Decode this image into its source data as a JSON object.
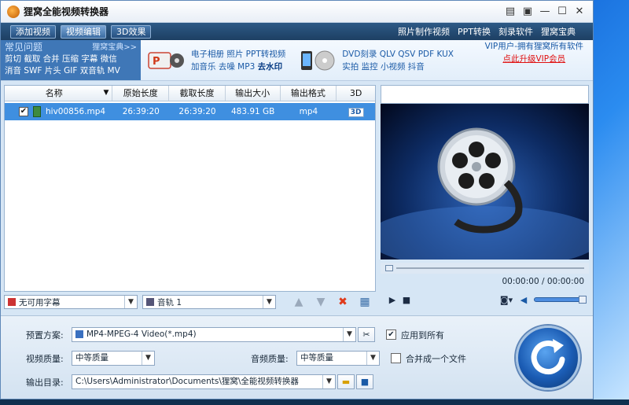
{
  "window": {
    "title": "狸窝全能视频转换器"
  },
  "window_controls": {
    "menu": "▤",
    "skin": "▣",
    "minimize": "—",
    "maximize": "☐",
    "close": "✕"
  },
  "toolbar": {
    "add_video": "添加视频",
    "edit_video": "视频编辑",
    "effect_3d": "3D效果",
    "links": [
      "照片制作视频",
      "PPT转换",
      "刻录软件",
      "狸窝宝典"
    ]
  },
  "banner": {
    "faq_title": "常见问题",
    "faq_more": "狸窝宝典>>",
    "faq_line1": "剪切 截取 合并 压缩 字幕 微信",
    "faq_line2": "消音 SWF 片头 GIF 双音轨 MV",
    "promo1_line1": "电子相册 照片 PPT转视频",
    "promo1_line2_a": "加音乐 去噪 MP3 ",
    "promo1_line2_b": "去水印",
    "promo2_line1": "DVD刻录 QLV QSV PDF KUX",
    "promo2_line2": "实拍 监控 小视频 抖音",
    "vip_line": "VIP用户-拥有狸窝所有软件",
    "vip_link": "点此升级VIP会员"
  },
  "filelist": {
    "headers": [
      "名称",
      "原始长度",
      "截取长度",
      "输出大小",
      "输出格式",
      "3D"
    ],
    "rows": [
      {
        "checked": "✔",
        "name": "hiv00856.mp4",
        "original": "26:39:20",
        "cut": "26:39:20",
        "size": "483.91 GB",
        "format": "mp4",
        "badge_3d": "3D"
      }
    ]
  },
  "player": {
    "time": "00:00:00 / 00:00:00"
  },
  "listbar": {
    "subtitle": "无可用字幕",
    "audio": "音轨 1"
  },
  "settings": {
    "preset_label": "预置方案:",
    "preset_value": "MP4-MPEG-4 Video(*.mp4)",
    "apply_all": "应用到所有",
    "video_quality_label": "视频质量:",
    "video_quality_value": "中等质量",
    "audio_quality_label": "音频质量:",
    "audio_quality_value": "中等质量",
    "merge_label": "合并成一个文件",
    "output_label": "输出目录:",
    "output_value": "C:\\Users\\Administrator\\Documents\\狸窝\\全能视频转换器"
  }
}
